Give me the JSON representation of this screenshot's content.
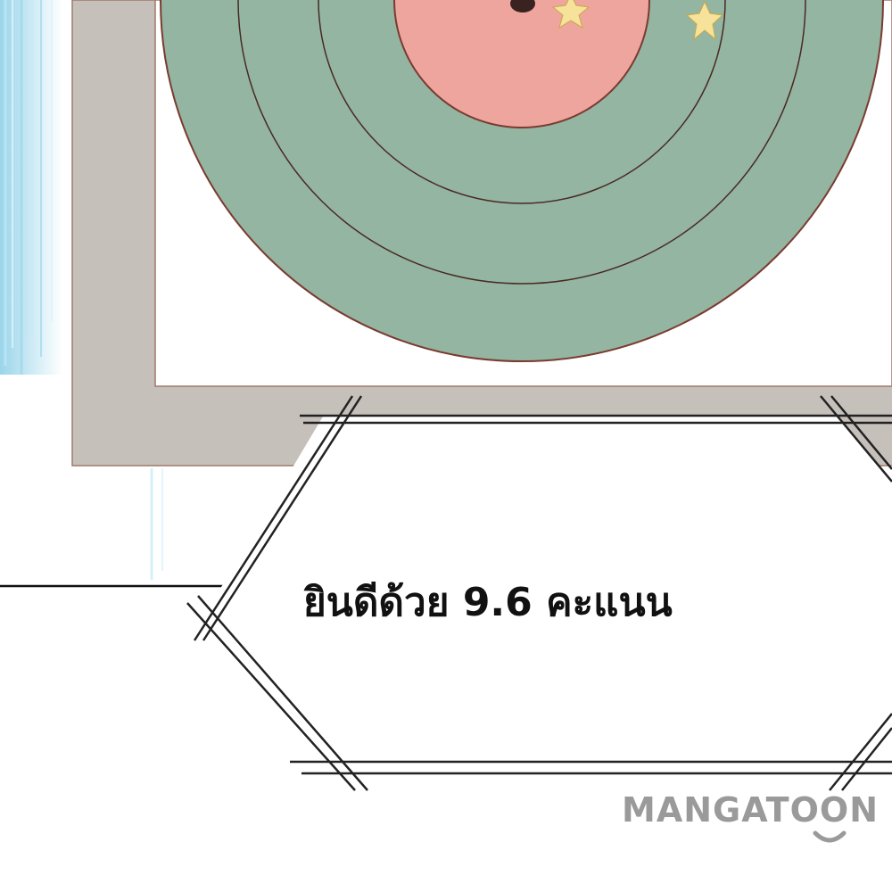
{
  "panel": {
    "caption": "ยินดีด้วย 9.6 คะแนน",
    "watermark": "MANGATOON"
  },
  "colors": {
    "ring_green": "#93b5a2",
    "bullseye": "#eea59d",
    "frame_gray": "#c6c0bb",
    "board_white": "#ffffff",
    "outline_brown": "#7a3b30",
    "speed_lines_blue": "#8fd0e8",
    "star_yellow": "#f6e29a",
    "watermark_gray": "#9a9a9a"
  },
  "icons": {
    "star_left": "star-icon",
    "star_right": "star-icon",
    "smile": "smile-icon"
  }
}
